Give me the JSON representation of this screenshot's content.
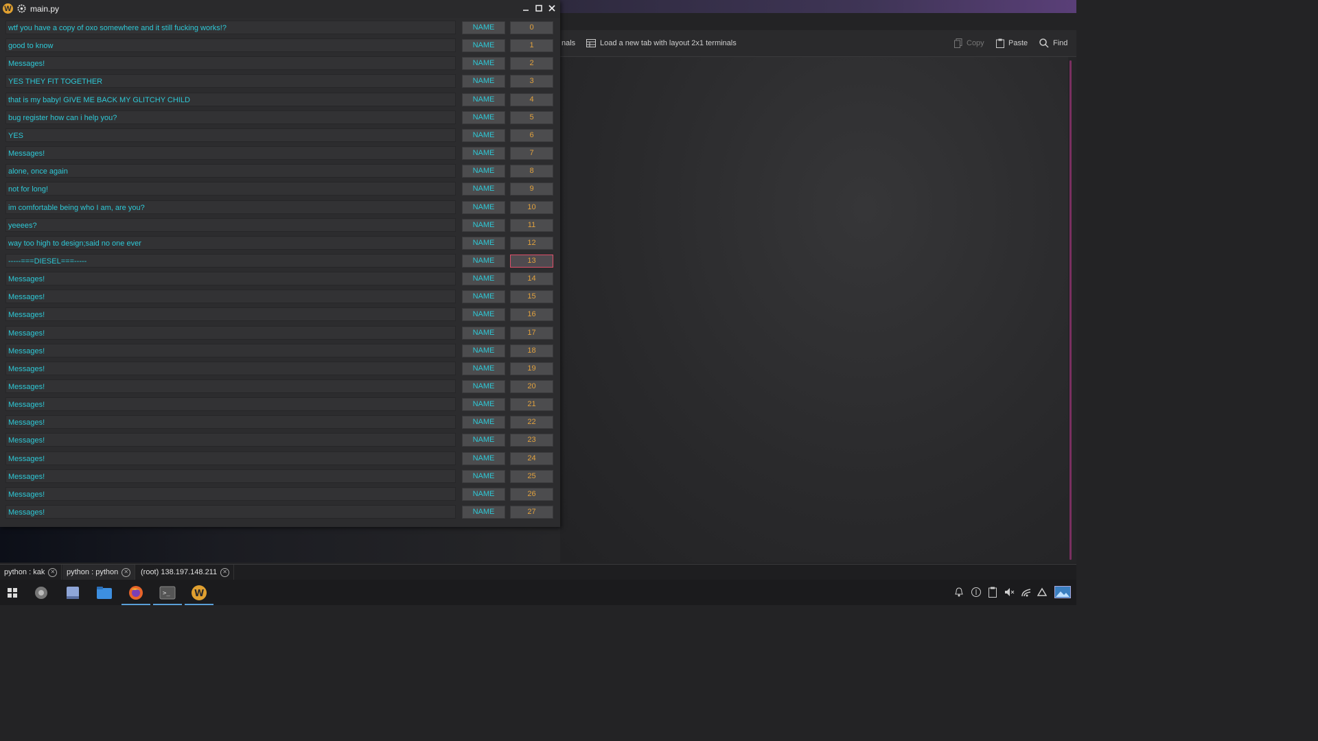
{
  "window": {
    "title": "main.py",
    "rows": [
      {
        "message": "wtf you have a copy of oxo somewhere and it still fucking works!?",
        "name": "NAME",
        "index": "0"
      },
      {
        "message": "good to know",
        "name": "NAME",
        "index": "1"
      },
      {
        "message": "Messages!",
        "name": "NAME",
        "index": "2"
      },
      {
        "message": "YES THEY FIT TOGETHER",
        "name": "NAME",
        "index": "3"
      },
      {
        "message": "that is my baby! GIVE ME BACK MY GLITCHY CHILD",
        "name": "NAME",
        "index": "4"
      },
      {
        "message": "bug register how can i help you?",
        "name": "NAME",
        "index": "5"
      },
      {
        "message": "YES",
        "name": "NAME",
        "index": "6"
      },
      {
        "message": "Messages!",
        "name": "NAME",
        "index": "7"
      },
      {
        "message": "alone, once again",
        "name": "NAME",
        "index": "8"
      },
      {
        "message": "not for long!",
        "name": "NAME",
        "index": "9"
      },
      {
        "message": "im comfortable being who I am, are you?",
        "name": "NAME",
        "index": "10"
      },
      {
        "message": "yeeees?",
        "name": "NAME",
        "index": "11"
      },
      {
        "message": "way too high to design;said no one ever",
        "name": "NAME",
        "index": "12"
      },
      {
        "message": "-----===DIESEL===-----",
        "name": "NAME",
        "index": "13",
        "selected": true
      },
      {
        "message": "Messages!",
        "name": "NAME",
        "index": "14"
      },
      {
        "message": "Messages!",
        "name": "NAME",
        "index": "15"
      },
      {
        "message": "Messages!",
        "name": "NAME",
        "index": "16"
      },
      {
        "message": "Messages!",
        "name": "NAME",
        "index": "17"
      },
      {
        "message": "Messages!",
        "name": "NAME",
        "index": "18"
      },
      {
        "message": "Messages!",
        "name": "NAME",
        "index": "19"
      },
      {
        "message": "Messages!",
        "name": "NAME",
        "index": "20"
      },
      {
        "message": "Messages!",
        "name": "NAME",
        "index": "21"
      },
      {
        "message": "Messages!",
        "name": "NAME",
        "index": "22"
      },
      {
        "message": "Messages!",
        "name": "NAME",
        "index": "23"
      },
      {
        "message": "Messages!",
        "name": "NAME",
        "index": "24"
      },
      {
        "message": "Messages!",
        "name": "NAME",
        "index": "25"
      },
      {
        "message": "Messages!",
        "name": "NAME",
        "index": "26"
      },
      {
        "message": "Messages!",
        "name": "NAME",
        "index": "27"
      }
    ]
  },
  "terminal": {
    "toolbar": {
      "partial_label": "nals",
      "new_tab_label": "Load a new tab with layout 2x1 terminals",
      "copy_label": "Copy",
      "paste_label": "Paste",
      "find_label": "Find"
    },
    "tabs": [
      {
        "label": "python : kak",
        "active": false
      },
      {
        "label": "python : python",
        "active": true
      },
      {
        "label": "(root) 138.197.148.211",
        "active": false
      }
    ]
  },
  "taskbar": {
    "apps": [
      "start-menu-icon",
      "settings-icon",
      "notes-icon",
      "file-manager-icon",
      "firefox-icon",
      "terminal-icon",
      "app-w-icon"
    ],
    "tray": [
      "notifications-icon",
      "updates-icon",
      "clipboard-icon",
      "volume-muted-icon",
      "network-icon",
      "arrow-up-icon",
      "desktop-preview-icon"
    ]
  },
  "colors": {
    "message_text": "#2ec9d7",
    "index_text": "#e2a23e",
    "selected_border": "#e0506a",
    "active_tab": "#d4344a"
  }
}
